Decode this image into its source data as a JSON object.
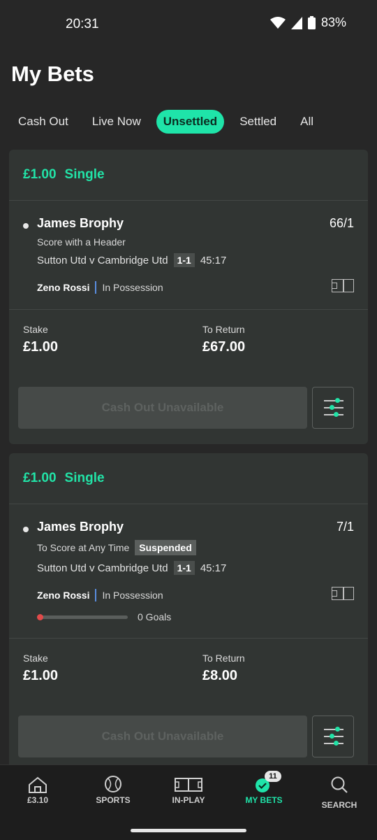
{
  "status": {
    "time": "20:31",
    "battery": "83%"
  },
  "page_title": "My Bets",
  "tabs": [
    {
      "label": "Cash Out",
      "active": false
    },
    {
      "label": "Live Now",
      "active": false
    },
    {
      "label": "Unsettled",
      "active": true
    },
    {
      "label": "Settled",
      "active": false
    },
    {
      "label": "All",
      "active": false
    }
  ],
  "bets": [
    {
      "stake_header": "£1.00",
      "bet_type": "Single",
      "selection": "James Brophy",
      "odds": "66/1",
      "market": "Score with a Header",
      "match": "Sutton Utd v Cambridge Utd",
      "score": "1-1",
      "match_time": "45:17",
      "player": "Zeno Rossi",
      "player_status": "In Possession",
      "stake_label": "Stake",
      "stake_value": "£1.00",
      "return_label": "To Return",
      "return_value": "£67.00",
      "cashout_label": "Cash Out Unavailable"
    },
    {
      "stake_header": "£1.00",
      "bet_type": "Single",
      "selection": "James Brophy",
      "odds": "7/1",
      "market": "To Score at Any Time",
      "market_badge": "Suspended",
      "match": "Sutton Utd v Cambridge Utd",
      "score": "1-1",
      "match_time": "45:17",
      "player": "Zeno Rossi",
      "player_status": "In Possession",
      "progress_label": "0 Goals",
      "progress": 0.0,
      "stake_label": "Stake",
      "stake_value": "£1.00",
      "return_label": "To Return",
      "return_value": "£8.00",
      "cashout_label": "Cash Out Unavailable"
    }
  ],
  "nav": [
    {
      "label": "£3.10",
      "icon": "home-icon"
    },
    {
      "label": "SPORTS",
      "icon": "ball-icon"
    },
    {
      "label": "IN-PLAY",
      "icon": "pitch-icon"
    },
    {
      "label": "MY BETS",
      "icon": "check-icon",
      "badge": "11",
      "active": true
    },
    {
      "label": "SEARCH",
      "icon": "search-icon"
    }
  ],
  "colors": {
    "accent": "#1fe4a9",
    "background": "#272727",
    "card": "#313533"
  }
}
